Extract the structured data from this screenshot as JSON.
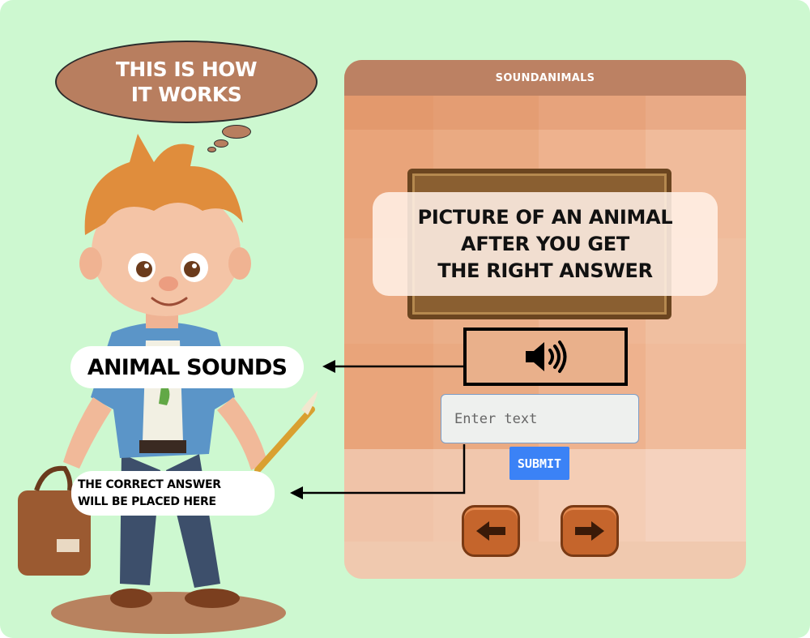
{
  "thought_bubble": {
    "line1": "THIS IS HOW",
    "line2": "IT WORKS"
  },
  "app": {
    "title": "SOUNDANIMALS",
    "picture_placeholder": {
      "line1": "PICTURE OF AN ANIMAL",
      "line2": "AFTER YOU GET",
      "line3": "THE RIGHT ANSWER"
    },
    "sound_button_icon": "speaker-volume-icon",
    "answer_input": {
      "value": "",
      "placeholder": "Enter text"
    },
    "submit_label": "SUBMIT",
    "prev_icon": "arrow-left-icon",
    "next_icon": "arrow-right-icon"
  },
  "annotations": {
    "animal_sounds": "ANIMAL SOUNDS",
    "correct_answer_line1": "THE CORRECT ANSWER",
    "correct_answer_line2": "WILL BE PLACED HERE"
  },
  "colors": {
    "background": "#cdf8d0",
    "accent_brown": "#b87e5f",
    "header": "#bc8163",
    "submit": "#3b82f6",
    "nav_button": "#c5652c"
  }
}
